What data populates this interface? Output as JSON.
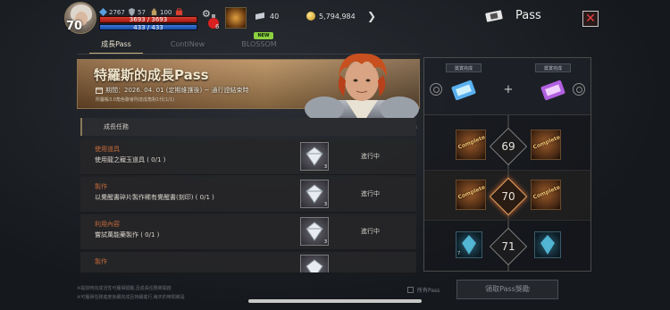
{
  "hud": {
    "level": "70",
    "stat1_value": "2767",
    "stat2_value": "57",
    "stat3_value": "100",
    "hp": {
      "text": "3693 / 3693",
      "fraction": 1.0
    },
    "mp": {
      "text": "433 / 433",
      "fraction": 1.0
    },
    "potion_count": "6",
    "silver": "40",
    "gold": "5,794,984",
    "more_icon": "chevron-right-icon",
    "colors": {
      "hp": "#d83a2e",
      "mp": "#3a78d8"
    }
  },
  "header": {
    "title": "Pass",
    "close_icon": "close-icon"
  },
  "tabs": [
    {
      "label": "成長Pass",
      "active": true
    },
    {
      "label": "ContiNew",
      "active": false
    },
    {
      "label": "BLOSSOM",
      "active": false
    }
  ],
  "new_badge": "NEW",
  "banner": {
    "title": "特羅斯的成長Pass",
    "period": "期間：2026. 04. 01 (定期維護後) ~ 通行證結束時",
    "note": "所屬帳3.0角色聯會則達成角對1代(1/1)"
  },
  "section": {
    "title": "成長任務"
  },
  "tasks": [
    {
      "category": "使用道具",
      "description": "使用龍之寵玉道具 ( 0/1 )",
      "reward_count": "3",
      "status": "進行中"
    },
    {
      "category": "製作",
      "description": "以覺醒書碎片製作稀有覺醒書(刻印) ( 0/1 )",
      "reward_count": "3",
      "status": "進行中"
    },
    {
      "category": "利用內容",
      "description": "嘗試萬能藥製作 ( 0/1 )",
      "reward_count": "3",
      "status": "進行中"
    },
    {
      "category": "製作",
      "description": "",
      "reward_count": "",
      "status": ""
    }
  ],
  "footer": {
    "note_line1": "※提前時完成活性可獲得獎勵,且成長任務將開啟",
    "note_line2": "※可獲得任務進度後續完成且持續進行,每天的時間將是",
    "all_pass_label": "所有Pass",
    "claim_button": "領取Pass獎勵"
  },
  "right_panel": {
    "free_label": "獎賞完成",
    "premium_label": "獎賞完成",
    "plus": "+",
    "rows": [
      {
        "level": "69",
        "active": false,
        "left": "Complete",
        "right": "Complete"
      },
      {
        "level": "70",
        "active": true,
        "left": "Complete",
        "right": "Complete"
      },
      {
        "level": "71",
        "active": false,
        "left_count": "7",
        "right_count": ""
      }
    ]
  }
}
